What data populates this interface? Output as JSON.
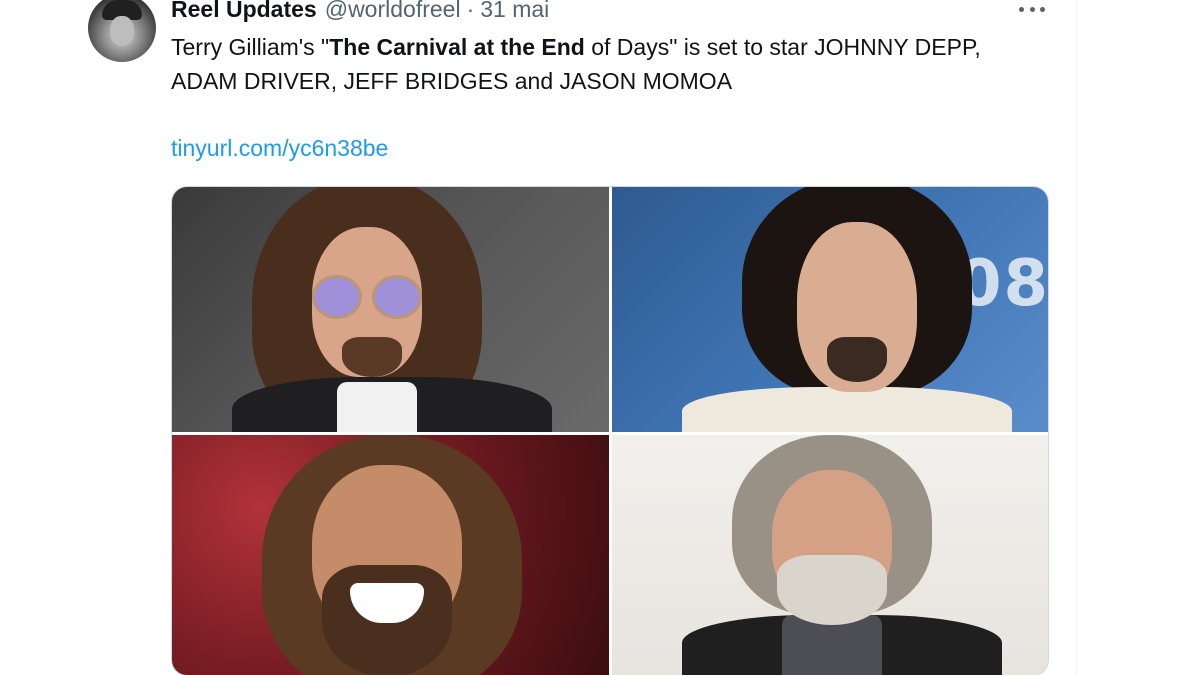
{
  "tweet": {
    "author": {
      "display_name": "Reel Updates",
      "handle": "@worldofreel",
      "separator": "·",
      "date": "31 mai"
    },
    "text": {
      "part1": "Terry Gilliam's \"",
      "bold": "The Carnival at the End",
      "part2": " of Days\" is set to star JOHNNY DEPP, ADAM DRIVER, JEFF BRIDGES and JASON MOMOA"
    },
    "link": "tinyurl.com/yc6n38be",
    "more_icon": "more-horizontal-icon",
    "media": [
      {
        "name": "photo-johnny-depp"
      },
      {
        "name": "photo-adam-driver",
        "backdrop_text": ".08"
      },
      {
        "name": "photo-jason-momoa"
      },
      {
        "name": "photo-jeff-bridges"
      }
    ]
  },
  "colors": {
    "link": "#1d9bf0",
    "secondary_text": "#536471",
    "primary_text": "#0f1419",
    "border": "#cfd9de"
  }
}
